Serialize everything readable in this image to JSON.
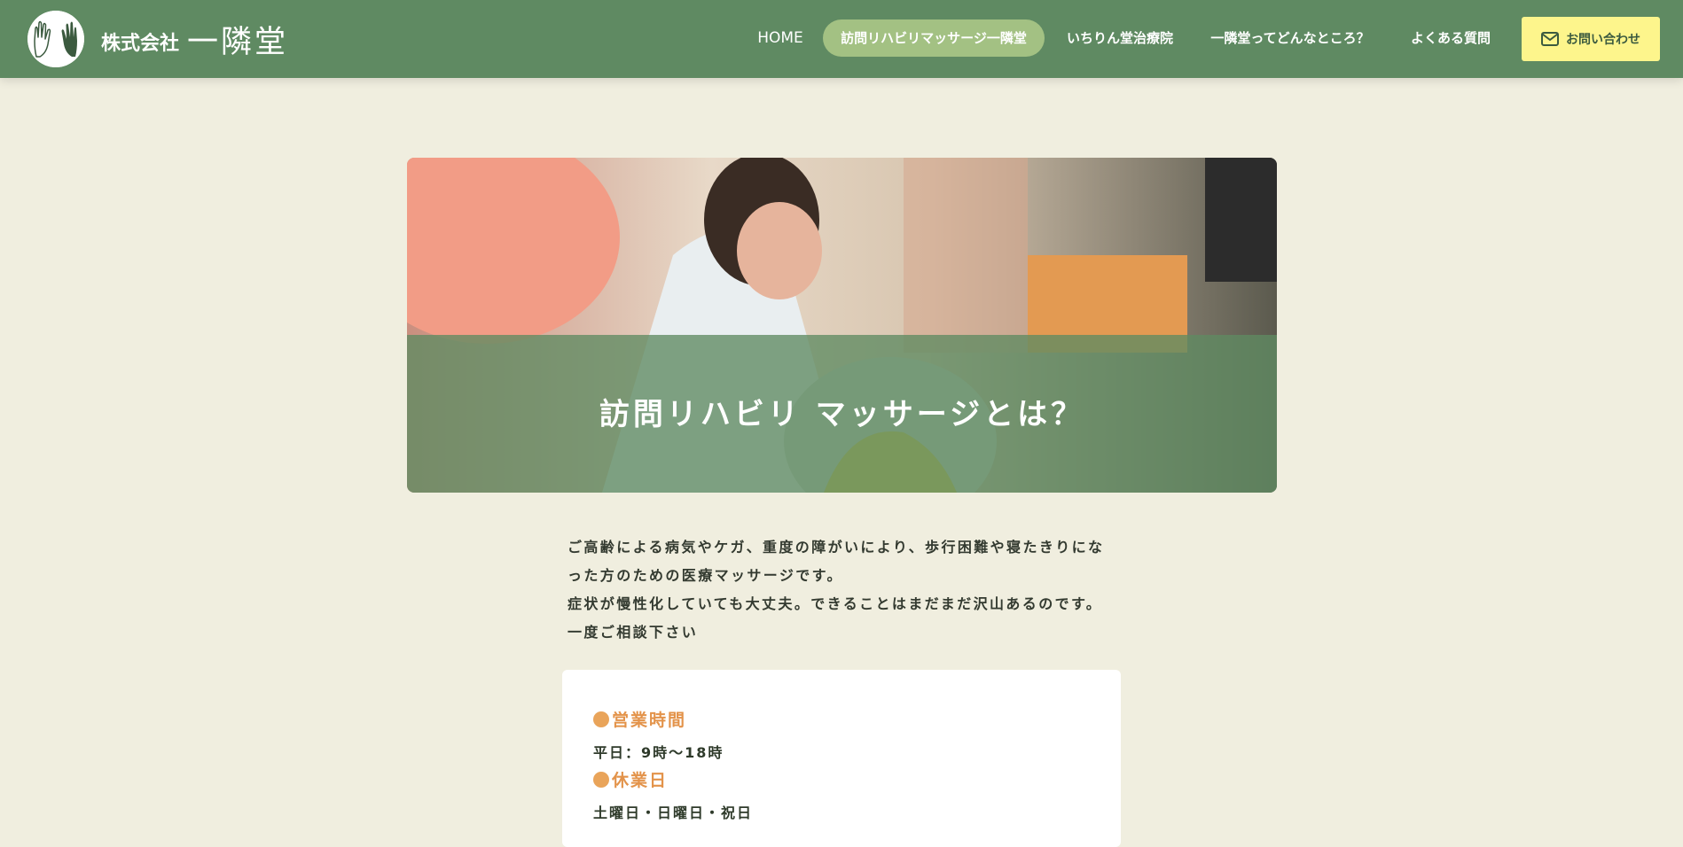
{
  "header": {
    "company_prefix": "株式会社",
    "company_name": "一隣堂",
    "nav": {
      "home": "HOME",
      "massage": "訪問リハビリマッサージ一隣堂",
      "clinic": "いちりん堂治療院",
      "about": "一隣堂ってどんなところ？",
      "faq": "よくある質問"
    },
    "contact_label": "お問い合わせ"
  },
  "hero": {
    "title": "訪問リハビリ マッサージとは？"
  },
  "intro": {
    "line1": "ご高齢による病気やケガ、重度の障がいにより、歩行困難や寝たきりにな",
    "line2": "った方のための医療マッサージです。",
    "line3": "症状が慢性化していても大丈夫。できることはまだまだ沢山あるのです。",
    "line4": "一度ご相談下さい"
  },
  "info": {
    "hours_heading": "営業時間",
    "hours_value": "平日：9時〜18時",
    "closed_heading": "休業日",
    "closed_value": "土曜日・日曜日・祝日"
  },
  "colors": {
    "header_green": "#5f8a62",
    "active_nav": "#a3c183",
    "contact_yellow": "#fdf58c",
    "page_bg": "#f0eedf",
    "accent_orange": "#e3934a"
  },
  "icons": {
    "logo": "hands-logo-icon",
    "contact": "mail-icon"
  }
}
